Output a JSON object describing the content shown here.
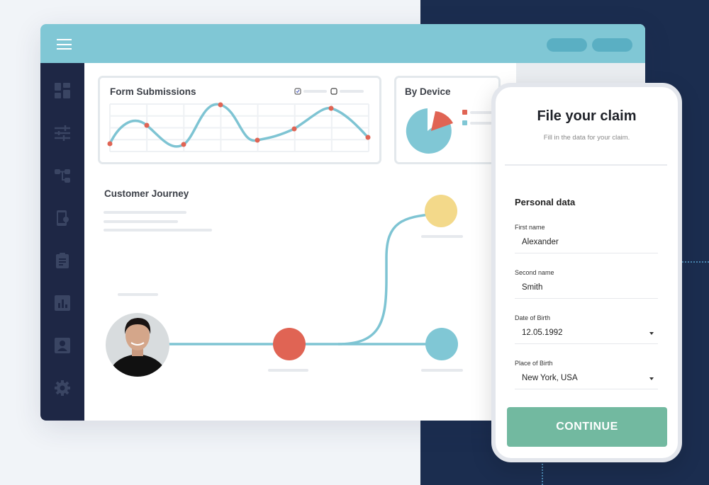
{
  "colors": {
    "header": "#80c7d5",
    "sidebar": "#1e2745",
    "line": "#7ec4d3",
    "point": "#e06454",
    "yellow": "#f3d98a",
    "button": "#72b9a0",
    "navy": "#1b2d4f"
  },
  "sidebar": {
    "icons": [
      "dashboard-icon",
      "sliders-icon",
      "hierarchy-icon",
      "phone-settings-icon",
      "clipboard-icon",
      "bar-chart-icon",
      "contact-icon",
      "gear-icon"
    ]
  },
  "form_submissions": {
    "title": "Form Submissions",
    "legend": [
      {
        "checked": true
      },
      {
        "checked": false
      }
    ]
  },
  "by_device": {
    "title": "By Device"
  },
  "journey": {
    "title": "Customer Journey"
  },
  "claim": {
    "title": "File your claim",
    "subtitle": "Fill in the data for your claim.",
    "section": "Personal data",
    "fields": [
      {
        "label": "First name",
        "value": "Alexander"
      },
      {
        "label": "Second name",
        "value": "Smith"
      },
      {
        "label": "Date of Birth",
        "value": "12.05.1992",
        "dropdown": true
      },
      {
        "label": "Place of Birth",
        "value": "New York, USA",
        "dropdown": true
      }
    ],
    "continue_label": "CONTINUE"
  }
}
